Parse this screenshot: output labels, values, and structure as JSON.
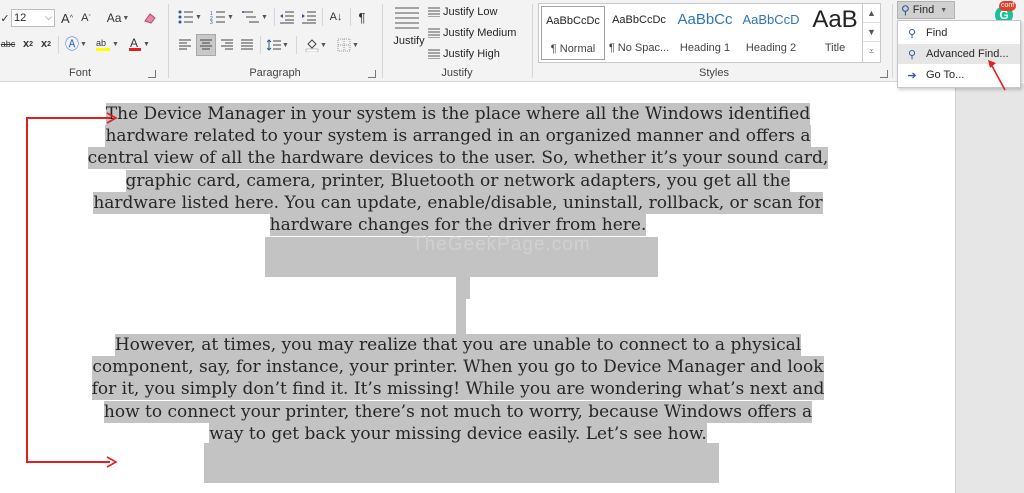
{
  "ribbon": {
    "font": {
      "size_value": "12",
      "grow_label": "A",
      "shrink_label": "A",
      "case_label": "Aa",
      "strike_label": "abc",
      "subscript_label": "x",
      "superscript_label": "x",
      "group_label": "Font"
    },
    "paragraph": {
      "sort_label": "A↓",
      "pilcrow_label": "¶",
      "group_label": "Paragraph"
    },
    "justify": {
      "main_label": "Justify",
      "options": [
        "Justify Low",
        "Justify Medium",
        "Justify High"
      ],
      "group_label": "Justify"
    },
    "styles": {
      "items": [
        {
          "preview": "AaBbCcDc",
          "name": "¶ Normal"
        },
        {
          "preview": "AaBbCcDc",
          "name": "¶ No Spac..."
        },
        {
          "preview": "AaBbCc",
          "name": "Heading 1"
        },
        {
          "preview": "AaBbCcD",
          "name": "Heading 2"
        },
        {
          "preview": "AaB",
          "name": "Title"
        }
      ],
      "group_label": "Styles"
    },
    "find": {
      "button_label": "Find",
      "menu": [
        "Find",
        "Advanced Find...",
        "Go To..."
      ]
    },
    "badge_label": "conf",
    "accent_color": "#2b579a",
    "annotation_color": "#e02020",
    "selection_color": "#c3c3c3"
  },
  "document": {
    "paragraphs": [
      {
        "lines": [
          "The Device Manager in your system is the place where all the Windows identified",
          "hardware related to your system is arranged in an organized manner and offers a",
          "central view of all the hardware devices to the user. So, whether it’s your sound card,",
          "graphic card, camera, printer, Bluetooth or network adapters, you get all the",
          "hardware listed here. You can update, enable/disable, uninstall, rollback, or scan for",
          "hardware changes for the driver from here."
        ]
      },
      {
        "lines": [
          "However, at times, you may realize that you are unable to connect to a physical",
          "component, say, for instance, your printer. When you go to Device Manager and look",
          "for it, you simply don’t find it. It’s missing! While you are wondering what’s next and",
          "how to connect your printer, there’s not much to worry, because Windows offers a",
          "way to get back your missing device easily. Let’s see how."
        ]
      }
    ],
    "watermark": "TheGeekPage.com"
  }
}
